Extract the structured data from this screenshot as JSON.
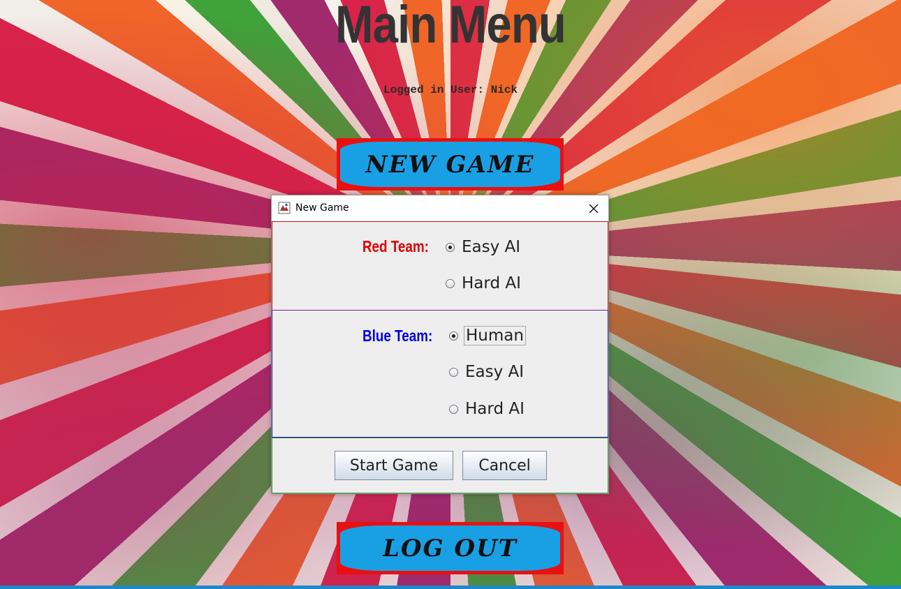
{
  "main_menu": {
    "title": "Main Menu",
    "logged_in_user": "Logged in User: Nick",
    "new_game_label": "NEW GAME",
    "log_out_label": "LOG OUT"
  },
  "dialog": {
    "title": "New Game",
    "red_team": {
      "label": "Red Team:",
      "color": "#e00000",
      "options": [
        "Easy AI",
        "Hard AI"
      ],
      "selected": "Easy AI"
    },
    "blue_team": {
      "label": "Blue Team:",
      "color": "#0000e6",
      "options": [
        "Human",
        "Easy AI",
        "Hard AI"
      ],
      "selected": "Human"
    },
    "start_label": "Start Game",
    "cancel_label": "Cancel"
  },
  "colors": {
    "button_fill": "#19a0e4",
    "button_border": "#e81010",
    "title_text": "#333333"
  }
}
